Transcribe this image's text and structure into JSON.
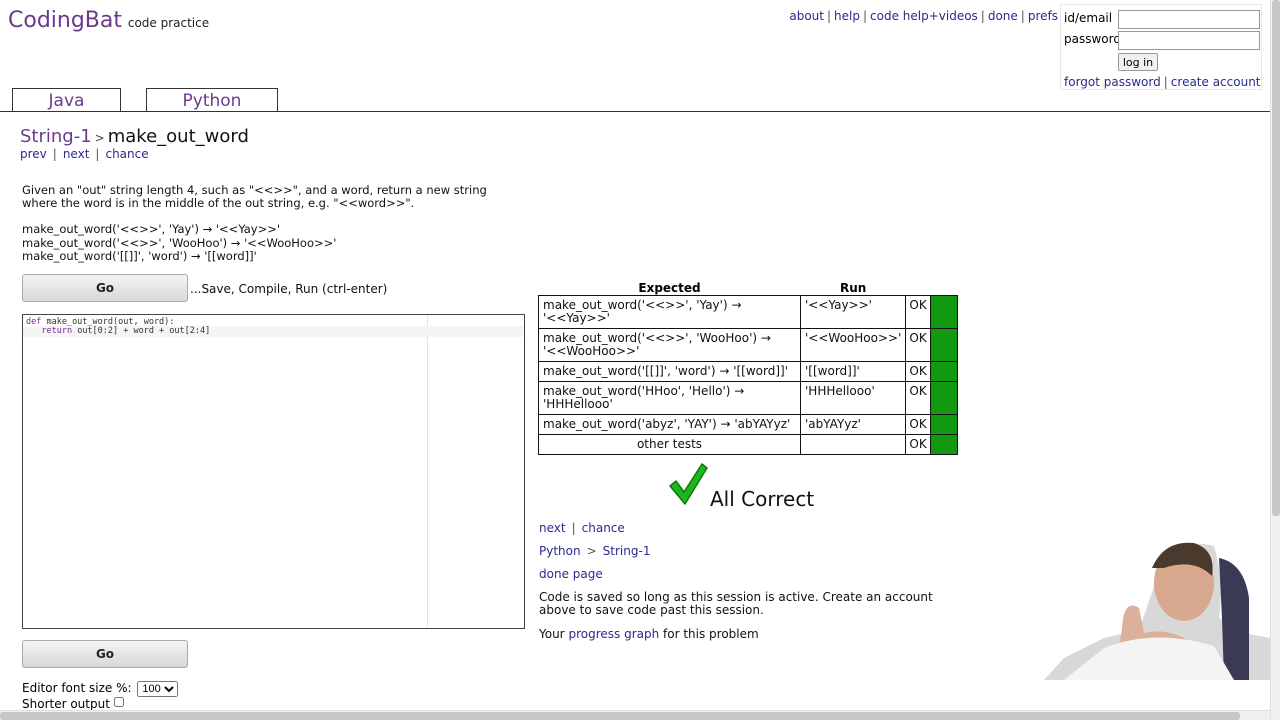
{
  "brand": {
    "name": "CodingBat",
    "subtitle": "code practice"
  },
  "topnav": {
    "items": [
      "about",
      "help",
      "code help+videos",
      "done",
      "prefs"
    ]
  },
  "login": {
    "id_label": "id/email",
    "password_label": "password",
    "button": "log in",
    "forgot": "forgot password",
    "create": "create account"
  },
  "tabs": [
    "Java",
    "Python"
  ],
  "problem": {
    "category": "String-1",
    "name": "make_out_word",
    "nav": [
      "prev",
      "next",
      "chance"
    ],
    "description": "Given an \"out\" string length 4, such as \"<<>>\", and a word, return a new string where the word is in the middle of the out string, e.g. \"<<word>>\".",
    "examples": [
      "make_out_word('<<>>', 'Yay') → '<<Yay>>'",
      "make_out_word('<<>>', 'WooHoo') → '<<WooHoo>>'",
      "make_out_word('[[]]', 'word') → '[[word]]'"
    ]
  },
  "go": {
    "label": "Go",
    "note": "...Save, Compile, Run (ctrl-enter)"
  },
  "editor": {
    "line1_kw": "def",
    "line1_rest": " make_out_word(out, word):",
    "line2_kw": "return",
    "line2_rest": " out[0:2] + word + out[2:4]"
  },
  "options": {
    "font_label": "Editor font size %:",
    "font_value": "100",
    "shorter_label": "Shorter output"
  },
  "results": {
    "headers": {
      "expected": "Expected",
      "run": "Run"
    },
    "rows": [
      {
        "expected": "make_out_word('<<>>', 'Yay') → '<<Yay>>'",
        "run": "'<<Yay>>'",
        "status": "OK"
      },
      {
        "expected": "make_out_word('<<>>', 'WooHoo') → '<<WooHoo>>'",
        "run": "'<<WooHoo>>'",
        "status": "OK"
      },
      {
        "expected": "make_out_word('[[]]', 'word') → '[[word]]'",
        "run": "'[[word]]'",
        "status": "OK"
      },
      {
        "expected": "make_out_word('HHoo', 'Hello') → 'HHHellooo'",
        "run": "'HHHellooo'",
        "status": "OK"
      },
      {
        "expected": "make_out_word('abyz', 'YAY') → 'abYAYyz'",
        "run": "'abYAYyz'",
        "status": "OK"
      }
    ],
    "other": {
      "label": "other tests",
      "status": "OK"
    },
    "pass_color": "#119911",
    "all_correct": "All Correct"
  },
  "after": {
    "next": "next",
    "chance": "chance",
    "path_lang": "Python",
    "path_sep": ">",
    "path_cat": "String-1",
    "done_page": "done page",
    "saved_note": "Code is saved so long as this session is active. Create an account above to save code past this session.",
    "progress_prefix": "Your",
    "progress_link": "progress graph",
    "progress_suffix": "for this problem"
  },
  "colors": {
    "brand": "#6b3a8c",
    "link": "#2a2a8c",
    "check": "#1fb51f"
  }
}
